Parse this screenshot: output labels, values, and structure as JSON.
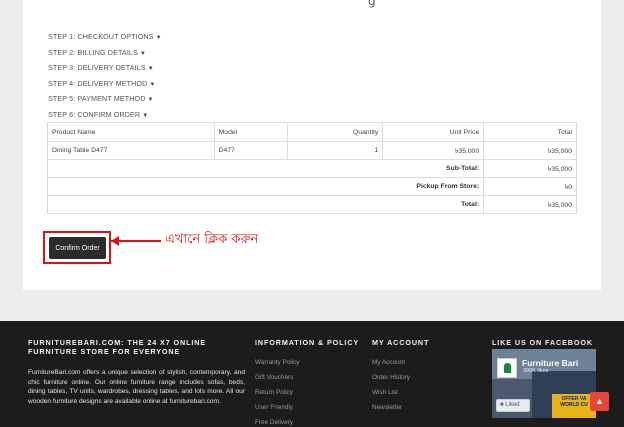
{
  "checkout_steps": [
    "STEP 1: CHECKOUT OPTIONS",
    "STEP 2: BILLING DETAILS",
    "STEP 3: DELIVERY DETAILS",
    "STEP 4: DELIVERY METHOD",
    "STEP 5: PAYMENT METHOD",
    "STEP 6: CONFIRM ORDER"
  ],
  "order_table": {
    "headers": {
      "product_name": "Product Name",
      "model": "Model",
      "quantity": "Quantity",
      "unit_price": "Unit Price",
      "total": "Total"
    },
    "rows": [
      {
        "product_name": "Dining Table D477",
        "model": "D477",
        "quantity": "1",
        "unit_price": "৳35,000",
        "total": "৳35,000"
      }
    ],
    "totals": [
      {
        "label": "Sub-Total:",
        "value": "৳35,000"
      },
      {
        "label": "Pickup From Store:",
        "value": "৳0"
      },
      {
        "label": "Total:",
        "value": "৳35,000"
      }
    ]
  },
  "confirm_button_label": "Confirm Order",
  "annotation_text": "এখানে ক্লিক করুন",
  "annotation_color": "#e01010",
  "footer": {
    "about": {
      "heading": "FURNITUREBARI.COM: THE 24 X7 ONLINE FURNITURE STORE FOR EVERYONE",
      "text": "FurnitureBari.com offers a unique selection of stylish, contemporary, and chic furniture online. Our online furniture range includes sofas, beds, dining tables, TV units, wardrobes, dressing tables, and lots more. All our wooden furniture designs are available online at furniturebari.com."
    },
    "info": {
      "heading": "INFORMATION & POLICY",
      "links": [
        "Warranty Policy",
        "Gift Vouchers",
        "Return Policy",
        "User Friendly",
        "Free Delivery"
      ]
    },
    "account": {
      "heading": "MY ACCOUNT",
      "links": [
        "My Account",
        "Order History",
        "Wish List",
        "Newsletter"
      ]
    },
    "facebook": {
      "heading": "LIKE US ON FACEBOOK",
      "page_name": "Furniture Bari",
      "likes": "390K likes",
      "liked_label": "Liked",
      "banner_text": "OFFER VA WORLD CU"
    }
  },
  "scroll_top_icon": "chevron-up-icon"
}
